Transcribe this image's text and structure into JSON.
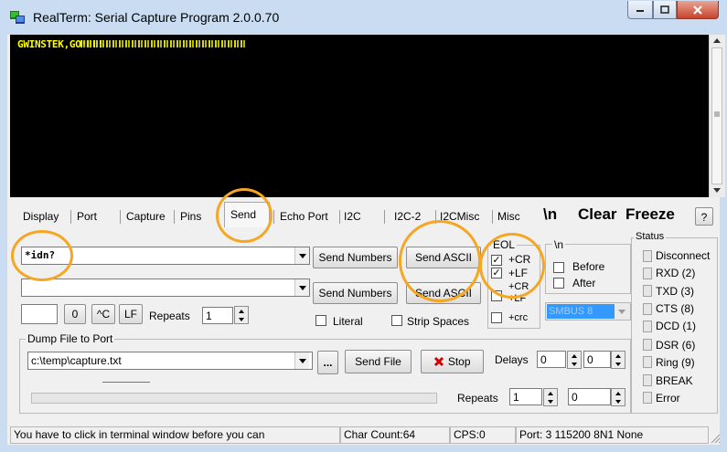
{
  "window": {
    "title": "RealTerm: Serial Capture Program 2.0.0.70",
    "min_icon": "minimize-icon",
    "max_icon": "maximize-icon",
    "close_icon": "close-icon"
  },
  "terminal": {
    "text": "GWINSTEK,GOM805",
    "text_color": "#ffff00",
    "background": "#000000"
  },
  "tabs": [
    "Display",
    "Port",
    "Capture",
    "Pins",
    "Send",
    "Echo Port",
    "I2C",
    "I2C-2",
    "I2CMisc",
    "Misc"
  ],
  "active_tab": "Send",
  "toolbar_right": {
    "newline": "\\n",
    "clear": "Clear",
    "freeze": "Freeze",
    "help": "?"
  },
  "send": {
    "input1_value": "*idn?",
    "input2_value": "",
    "send_numbers_1": "Send Numbers",
    "send_ascii_1": "Send ASCII",
    "send_numbers_2": "Send Numbers",
    "send_ascii_2": "Send ASCII",
    "small_input_value": "",
    "zero_button": "0",
    "ctrl_c_button": "^C",
    "lf_button": "LF",
    "repeats_label": "Repeats",
    "repeats_value": "1",
    "literal_label": "Literal",
    "strip_spaces_label": "Strip Spaces"
  },
  "eol": {
    "title": "EOL",
    "cr_label": "+CR",
    "lf_label": "+LF",
    "cr2_label": "+CR",
    "lf2_label": "+LF",
    "crc_label": "+crc",
    "cr_checked": true,
    "lf_checked": true
  },
  "newline_group": {
    "title": "\\n",
    "before_label": "Before",
    "after_label": "After",
    "smbus_value": "SMBUS 8"
  },
  "status": {
    "title": "Status",
    "items": [
      "Disconnect",
      "RXD (2)",
      "TXD (3)",
      "CTS (8)",
      "DCD (1)",
      "DSR (6)",
      "Ring (9)",
      "BREAK",
      "Error"
    ]
  },
  "dump": {
    "title": "Dump File to Port",
    "file_path": "c:\\temp\\capture.txt",
    "browse_label": "...",
    "send_file_label": "Send File",
    "stop_label": "Stop",
    "delays_label": "Delays",
    "delay1_value": "0",
    "delay2_value": "0",
    "repeats_label": "Repeats",
    "repeats1_value": "1",
    "repeats2_value": "0"
  },
  "statusbar": {
    "hint": "You have to click in terminal window before you can",
    "char_count": "Char Count:64",
    "cps": "CPS:0",
    "port": "Port: 3 115200 8N1 None"
  },
  "highlight_color": "#f5a623"
}
